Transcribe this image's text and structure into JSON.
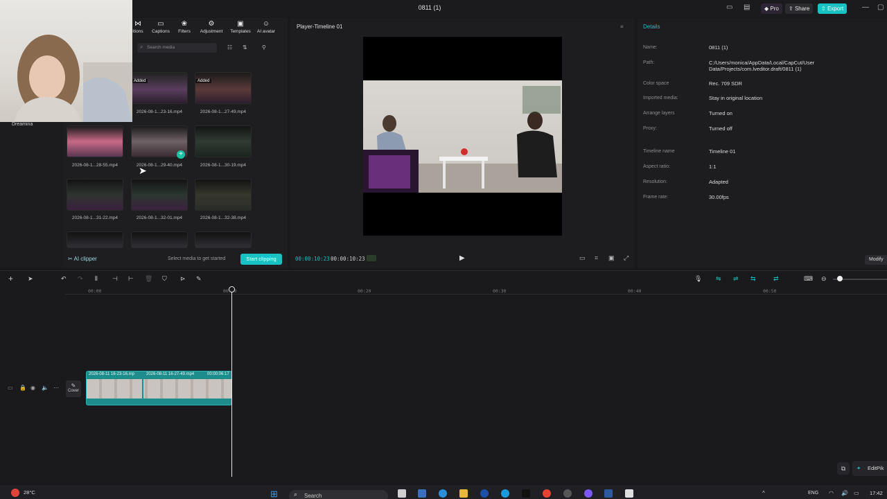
{
  "window": {
    "title": "0811 (1)"
  },
  "header_buttons": {
    "pro": "Pro",
    "share": "Share",
    "export": "Export"
  },
  "toolbar": {
    "items": [
      {
        "label": "itions",
        "icon": "transitions-icon"
      },
      {
        "label": "Captions",
        "icon": "captions-icon"
      },
      {
        "label": "Filters",
        "icon": "filters-icon"
      },
      {
        "label": "Adjustment",
        "icon": "adjustment-icon"
      },
      {
        "label": "Templates",
        "icon": "templates-icon"
      },
      {
        "label": "AI avatar",
        "icon": "ai-avatar-icon"
      }
    ]
  },
  "media": {
    "search_placeholder": "Search media",
    "sidebar_item": "Dreamina",
    "added_tag": "Added",
    "thumbnails": [
      "2026-08-1...23-16.mp4",
      "2026-08-1...27-49.mp4",
      "2026-08-1...28-55.mp4",
      "2026-08-1...29-40.mp4",
      "2026-08-1...30-19.mp4",
      "2026-08-1...31-22.mp4",
      "2026-08-1...32-01.mp4",
      "2026-08-1...32-38.mp4"
    ],
    "ai_clipper": "AI clipper",
    "hint": "Select media to get started",
    "start_clipping": "Start clipping"
  },
  "player": {
    "title": "Player-Timeline 01",
    "current_time": "00:00:10:23",
    "total_time": "00:00:10:23"
  },
  "details": {
    "title": "Details",
    "rows": [
      {
        "key": "Name:",
        "value": "0811 (1)"
      },
      {
        "key": "Path:",
        "value": "C:/Users/monica/AppData/Local/CapCut/User Data/Projects/com.lveditor.draft/0811 (1)"
      },
      {
        "key": "Color space",
        "value": "Rec. 709 SDR"
      },
      {
        "key": "Imported media:",
        "value": "Stay in original location"
      },
      {
        "key": "Arrange layers",
        "value": "Turned on"
      },
      {
        "key": "Proxy:",
        "value": "Turned off"
      },
      {
        "key": "Timeline name",
        "value": "Timeline 01"
      },
      {
        "key": "Aspect ratio:",
        "value": "1:1"
      },
      {
        "key": "Resolution:",
        "value": "Adapted"
      },
      {
        "key": "Frame rate:",
        "value": "30.00fps"
      }
    ],
    "modify": "Modify"
  },
  "timeline": {
    "ruler": [
      "00:00",
      "00:10",
      "00:20",
      "00:30",
      "00:40",
      "00:50"
    ],
    "cover": "Cover",
    "clips": [
      "2026-08-11 16-23-16.mp",
      "2026-08-11 16-27-49.mp4",
      "00:00:06:17"
    ]
  },
  "taskbar": {
    "weather": "28°C",
    "search": "Search",
    "lang": "ENG",
    "clock": "17:42"
  },
  "popup": {
    "editpik": "EditPik"
  }
}
